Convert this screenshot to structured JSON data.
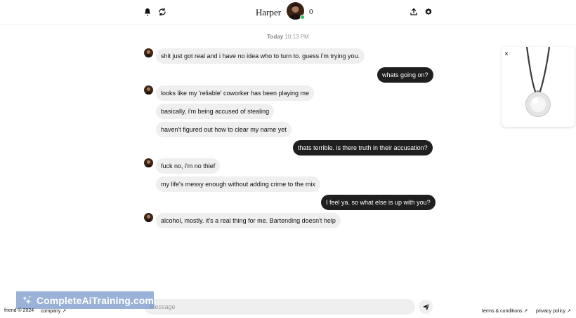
{
  "header": {
    "contact_name": "Harper",
    "count": "0"
  },
  "timestamp": {
    "day": "Today",
    "time": "10:13 PM"
  },
  "messages": [
    {
      "from": "contact",
      "text": "shit just got real and i have no idea who to turn to. guess i'm trying you."
    },
    {
      "from": "user",
      "text": "whats going on?"
    },
    {
      "from": "contact",
      "text": "looks like my 'reliable' coworker has been playing me"
    },
    {
      "from": "contact",
      "text": "basically, i'm being accused of stealing"
    },
    {
      "from": "contact",
      "text": "haven't figured out how to clear my name yet"
    },
    {
      "from": "user",
      "text": "thats terrible. is there truth in their accusation?"
    },
    {
      "from": "contact",
      "text": "fuck no, i'm no thief"
    },
    {
      "from": "contact",
      "text": "my life's messy enough without adding crime to the mix"
    },
    {
      "from": "user",
      "text": "I feel ya. so what else is up with you?"
    },
    {
      "from": "contact",
      "text": "alcohol, mostly. it's a real thing for me. Bartending doesn't help"
    }
  ],
  "product_card": {
    "close_label": "×"
  },
  "composer": {
    "placeholder": "Message"
  },
  "watermark": {
    "text": "CompleteAiTraining.com"
  },
  "footer": {
    "copyright": "friend © 2024",
    "company_link": "company ↗",
    "terms_link": "terms & conditions ↗",
    "privacy_link": "privacy policy ↗"
  },
  "icons": {
    "bell": "bell-icon",
    "refresh": "refresh-icon",
    "upload": "upload-icon",
    "settings": "gear-icon",
    "send": "send-icon",
    "close": "close-icon"
  }
}
